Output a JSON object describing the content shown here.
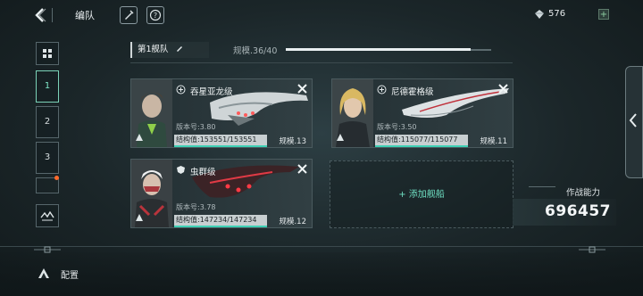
{
  "header": {
    "back_icon": "chevron-left-icon",
    "title": "编队",
    "currency_value": "576",
    "currency_icon": "crystal-icon",
    "plus_label": "+"
  },
  "fleet": {
    "tab_label": "第1舰队",
    "scale_label": "规模.36/40",
    "scale_current": 36,
    "scale_max": 40
  },
  "nav": {
    "fleets": [
      "1",
      "2",
      "3"
    ],
    "active": "1"
  },
  "ships": [
    {
      "name": "吞星亚龙级",
      "version": "版本号:3.80",
      "hp": "结构值:153551/153551",
      "scale": "规模.13",
      "hp_ratio": 1.0
    },
    {
      "name": "尼德霍格级",
      "version": "版本号:3.50",
      "hp": "结构值:115077/115077",
      "scale": "规模.11",
      "hp_ratio": 1.0
    },
    {
      "name": "虫群级",
      "version": "版本号:3.78",
      "hp": "结构值:147234/147234",
      "scale": "规模.12",
      "hp_ratio": 1.0
    }
  ],
  "empty_slot": {
    "label": "+ 添加舰船"
  },
  "power": {
    "label": "作战能力",
    "value": "696457"
  },
  "bottom": {
    "config_label": "配置"
  },
  "colors": {
    "accent": "#6fe0c3",
    "hp_bar": "#3dd1b5",
    "active_border": "#7bd3b8"
  }
}
